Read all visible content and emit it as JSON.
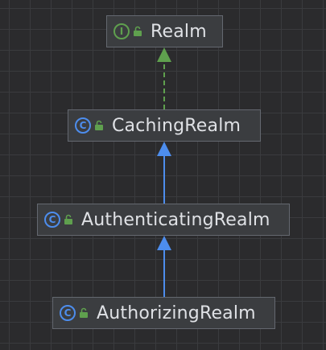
{
  "diagram": {
    "nodes": [
      {
        "id": "realm",
        "kind": "interface",
        "kind_letter": "I",
        "name": "Realm"
      },
      {
        "id": "caching",
        "kind": "class",
        "kind_letter": "C",
        "name": "CachingRealm"
      },
      {
        "id": "authenticating",
        "kind": "class",
        "kind_letter": "C",
        "name": "AuthenticatingRealm"
      },
      {
        "id": "authorizing",
        "kind": "class",
        "kind_letter": "C",
        "name": "AuthorizingRealm"
      }
    ],
    "edges": [
      {
        "from": "CachingRealm",
        "to": "Realm",
        "relation": "implements",
        "style": "dashed"
      },
      {
        "from": "AuthenticatingRealm",
        "to": "CachingRealm",
        "relation": "extends",
        "style": "solid"
      },
      {
        "from": "AuthorizingRealm",
        "to": "AuthenticatingRealm",
        "relation": "extends",
        "style": "solid"
      }
    ],
    "colors": {
      "background": "#2b2b2d",
      "grid": "#3a3b3e",
      "node_fill": "#3b3d40",
      "node_border": "#646870",
      "text": "#dfe1e5",
      "interface_icon": "#5fa04e",
      "class_icon": "#4d8ded",
      "lock_icon": "#5fa04e",
      "implements_edge": "#5fa04e",
      "extends_edge": "#4d8ded"
    }
  }
}
